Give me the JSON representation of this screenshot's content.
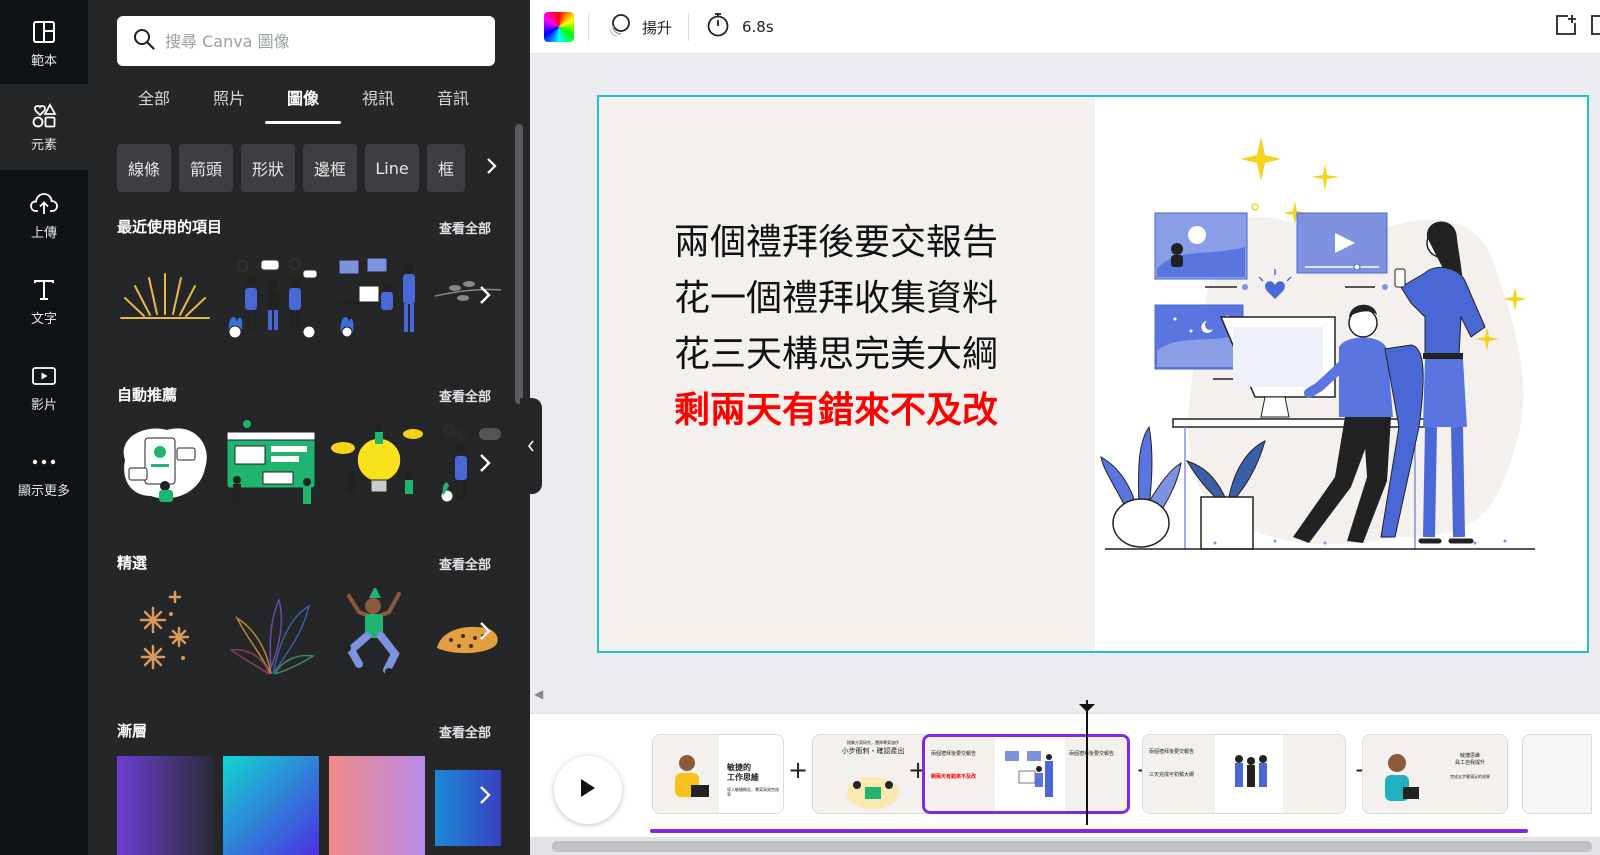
{
  "rail": {
    "items": [
      {
        "label": "範本",
        "icon": "layout-icon"
      },
      {
        "label": "元素",
        "icon": "shapes-icon",
        "active": true
      },
      {
        "label": "上傳",
        "icon": "cloud-upload-icon"
      },
      {
        "label": "文字",
        "icon": "text-icon"
      },
      {
        "label": "影片",
        "icon": "video-icon"
      },
      {
        "label": "顯示更多",
        "icon": "more-icon"
      }
    ]
  },
  "panel": {
    "search_placeholder": "搜尋 Canva 圖像",
    "tabs": [
      "全部",
      "照片",
      "圖像",
      "視訊",
      "音訊"
    ],
    "active_tab": "圖像",
    "chips": [
      "線條",
      "箭頭",
      "形狀",
      "邊框",
      "Line",
      "框"
    ],
    "see_all": "查看全部",
    "sections": [
      "最近使用的項目",
      "自動推薦",
      "精選",
      "漸層"
    ]
  },
  "toolbar": {
    "animation_label": "揚升",
    "duration_label": "6.8s"
  },
  "canvas": {
    "lines": [
      "兩個禮拜後要交報告",
      "花一個禮拜收集資料",
      "花三天構思完美大綱"
    ],
    "highlight_line": "剩兩天有錯來不及改",
    "highlight_color": "#ff0000",
    "selection_color": "#25c0cc"
  },
  "timeline": {
    "accent": "#7d2ae8",
    "pages": [
      {
        "title": "敏捷的\n工作思維",
        "sub": "導入敏捷概念，專案高效完成率"
      },
      {
        "title": "小步衝刺・確認產出",
        "sub": "搜集方案研究，團隊專案協作"
      },
      {
        "title": "兩個禮拜後要交報告",
        "sub": "剩兩天有錯來不及改"
      },
      {
        "title": "兩個禮拜後要交報告",
        "sub": "三天完成可初稿大綱"
      },
      {
        "title": "敏捷思維\n員工自我提升",
        "sub": "完成五步驟滿足的成果"
      }
    ]
  }
}
